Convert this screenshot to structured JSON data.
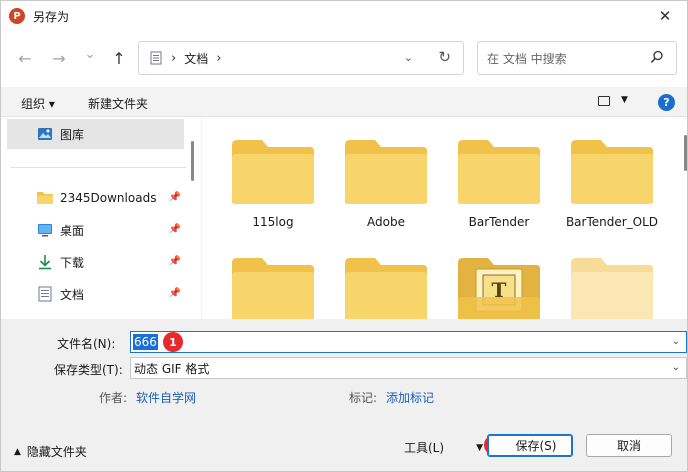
{
  "titlebar": {
    "title": "另存为",
    "app_icon": "P",
    "close_icon": "✕"
  },
  "nav": {
    "back_icon": "←",
    "forward_icon": "→",
    "recent_icon": "⌄",
    "up_icon": "↑",
    "path_sep": "›",
    "path_folder": "文档",
    "path_sep2": "›",
    "dropdown_icon": "⌄",
    "refresh_icon": "↻",
    "search_placeholder": "在 文档 中搜索"
  },
  "toolbar": {
    "organize": "组织 ▾",
    "new_folder": "新建文件夹",
    "view_arrow": "▼",
    "help": "?"
  },
  "sidebar": {
    "items": [
      {
        "label": "图库",
        "icon": "gallery-icon"
      },
      {
        "label": "2345Downloads",
        "icon": "folder-icon",
        "pin": "📌"
      },
      {
        "label": "桌面",
        "icon": "desktop-icon",
        "pin": "📌"
      },
      {
        "label": "下载",
        "icon": "download-icon",
        "pin": "📌"
      },
      {
        "label": "文档",
        "icon": "document-icon",
        "pin": "📌"
      }
    ]
  },
  "files": {
    "folders": [
      {
        "name": "115log"
      },
      {
        "name": "Adobe"
      },
      {
        "name": "BarTender"
      },
      {
        "name": "BarTender_OLD"
      },
      {
        "name": ""
      },
      {
        "name": ""
      },
      {
        "name": "",
        "badge_letter": "T"
      },
      {
        "name": ""
      }
    ]
  },
  "form": {
    "filename_label": "文件名(N):",
    "filename_value": "666",
    "filetype_label": "保存类型(T):",
    "filetype_value": "动态 GIF 格式",
    "author_label": "作者:",
    "author_value": "软件自学网",
    "tags_label": "标记:",
    "tags_value": "添加标记",
    "hide_folders": "隐藏文件夹",
    "hide_caret": "▲",
    "tools": "工具(L)",
    "tools_arrow": "▼",
    "save": "保存(S)",
    "cancel": "取消",
    "badge1": "1",
    "badge2": "2",
    "dropdown_arrow": "⌄"
  },
  "colors": {
    "accent": "#1a6fd6",
    "badge": "#e8292b",
    "folder": "#f8d56b",
    "folder_dark": "#f1c24a"
  }
}
